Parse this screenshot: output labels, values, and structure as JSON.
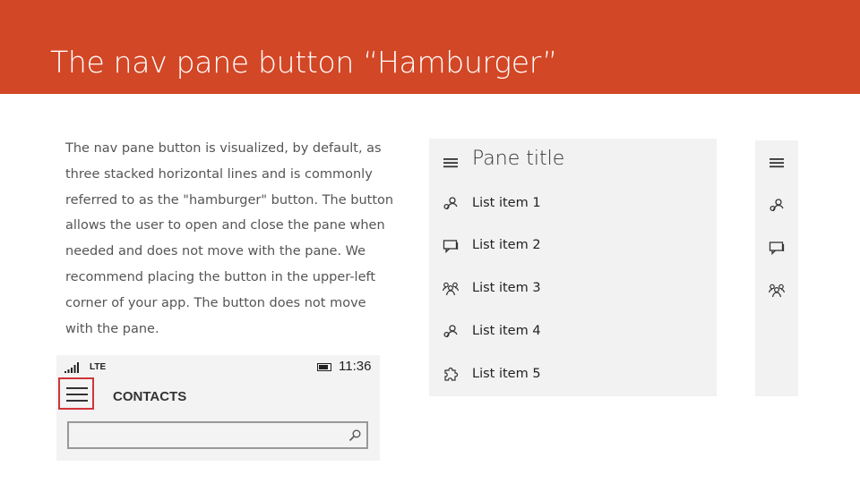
{
  "slide": {
    "title": "The nav pane button “Hamburger”",
    "description": "The nav pane button is visualized, by default, as three stacked horizontal lines and is commonly referred to as the \"hamburger\" button. The button allows the user to open and close the pane when needed and does not move with the pane. We recommend placing the button in the upper-left corner of your app. The button does not move with the pane."
  },
  "phone": {
    "status": {
      "network": "LTE",
      "time": "11:36"
    },
    "header_title": "CONTACTS",
    "search_value": "",
    "icons": [
      "signal-icon",
      "battery-icon",
      "hamburger-icon",
      "search-icon"
    ]
  },
  "pane": {
    "title": "Pane title",
    "title_icon": "hamburger-icon",
    "items": [
      {
        "label": "List item 1",
        "icon": "person-icon"
      },
      {
        "label": "List item 2",
        "icon": "chat-icon"
      },
      {
        "label": "List item 3",
        "icon": "people-icon"
      },
      {
        "label": "List item 4",
        "icon": "person-icon"
      },
      {
        "label": "List item 5",
        "icon": "puzzle-icon"
      }
    ]
  },
  "compact_pane": {
    "icons": [
      "hamburger-icon",
      "person-icon",
      "chat-icon",
      "people-icon"
    ]
  },
  "colors": {
    "banner": "#d24726",
    "highlight_border": "#d13438",
    "pane_background": "#f2f2f2"
  }
}
